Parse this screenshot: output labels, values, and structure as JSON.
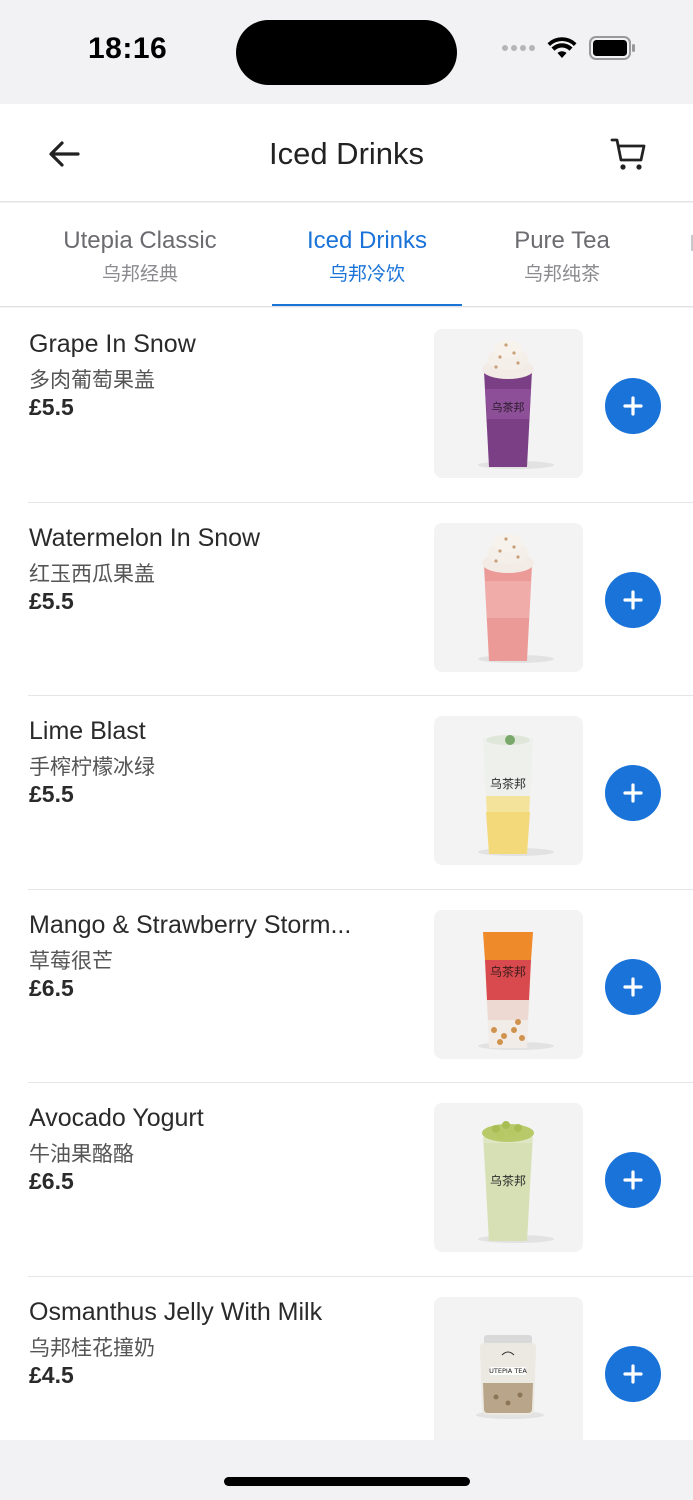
{
  "status_bar": {
    "time": "18:16"
  },
  "header": {
    "title": "Iced Drinks",
    "back_icon": "arrow-left-icon",
    "cart_icon": "shopping-cart-icon"
  },
  "tabs": [
    {
      "label": "Utepia Classic",
      "sublabel": "乌邦经典",
      "active": false
    },
    {
      "label": "Iced Drinks",
      "sublabel": "乌邦冷饮",
      "active": true
    },
    {
      "label": "Pure Tea",
      "sublabel": "乌邦纯茶",
      "active": false
    }
  ],
  "items": [
    {
      "name": "Grape In Snow",
      "name_zh": "多肉葡萄果盖",
      "price": "£5.5"
    },
    {
      "name": "Watermelon In Snow",
      "name_zh": "红玉西瓜果盖",
      "price": "£5.5"
    },
    {
      "name": "Lime Blast",
      "name_zh": "手榨柠檬冰绿",
      "price": "£5.5"
    },
    {
      "name": "Mango & Strawberry Storm...",
      "name_zh": "草莓很芒",
      "price": "£6.5"
    },
    {
      "name": "Avocado Yogurt",
      "name_zh": "牛油果酪酪",
      "price": "£6.5"
    },
    {
      "name": "Osmanthus Jelly With Milk",
      "name_zh": "乌邦桂花撞奶",
      "price": "£4.5"
    }
  ],
  "cup_logo_text": "乌茶邦",
  "bottle_label_text": "UTEPIA TEA",
  "colors": {
    "accent": "#1a73d9",
    "background": "#f2f2f4",
    "surface": "#ffffff"
  }
}
